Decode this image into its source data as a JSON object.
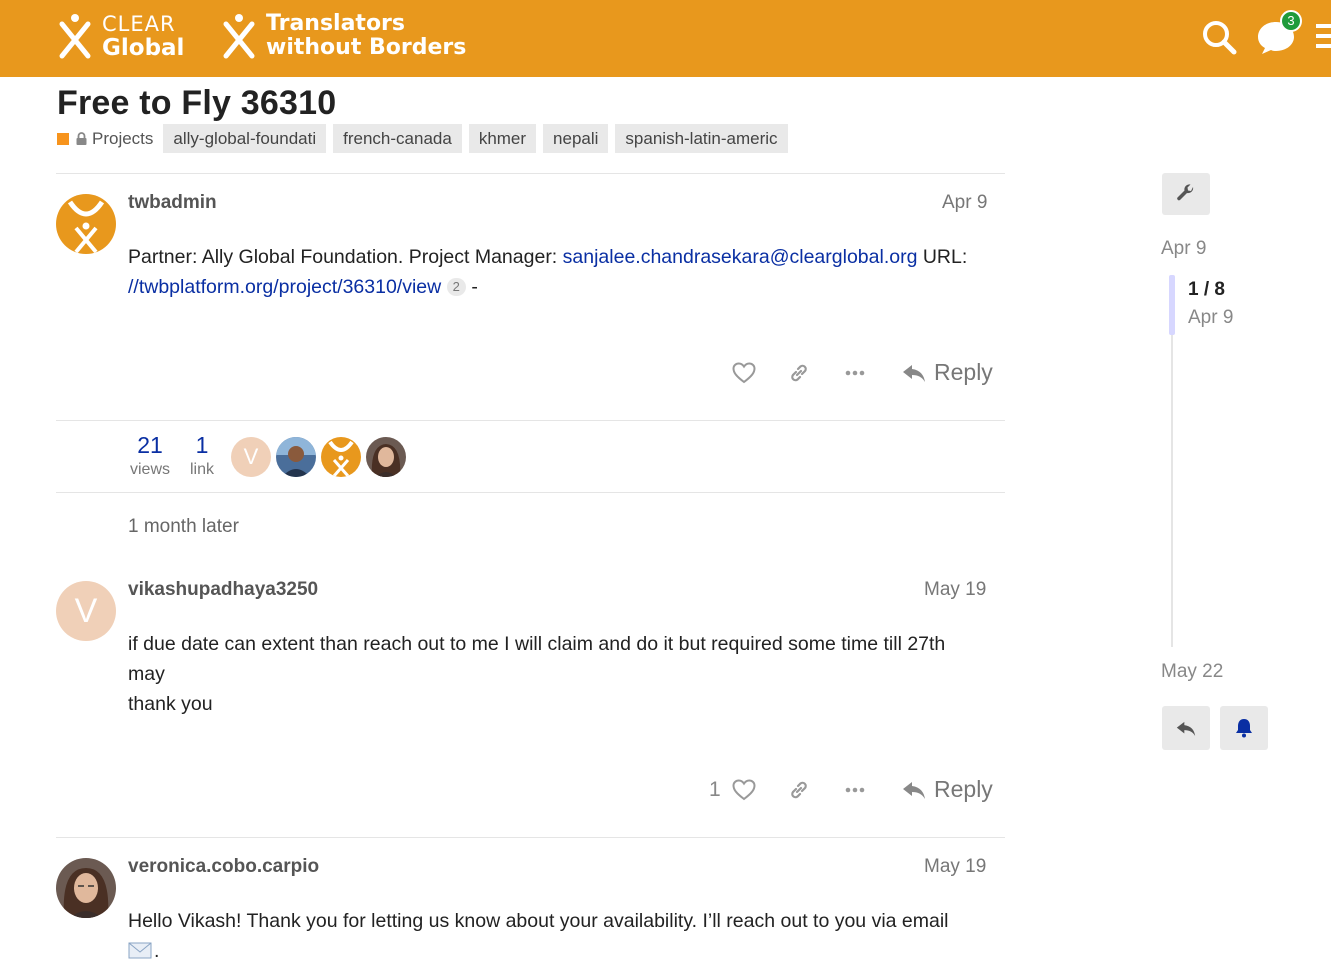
{
  "header": {
    "logo1": {
      "line1": "CLEAR",
      "line2": "Global"
    },
    "logo2": {
      "line1": "Translators",
      "line2": "without Borders"
    },
    "chat_badge": "3",
    "bg_color": "#E8981D"
  },
  "topic": {
    "title": "Free to Fly 36310",
    "category": "Projects",
    "category_color": "#F7941D",
    "tags": [
      "ally-global-foundati",
      "french-canada",
      "khmer",
      "nepali",
      "spanish-latin-americ"
    ]
  },
  "posts": [
    {
      "username": "twbadmin",
      "date": "Apr 9",
      "body_prefix": "Partner: Ally Global Foundation. Project Manager: ",
      "email": "sanjalee.chandrasekara@clearglobal.org",
      "body_mid": " URL:",
      "url": "//twbplatform.org/project/36310/view",
      "url_clicks": "2",
      "body_suffix": " -",
      "reply_label": "Reply"
    },
    {
      "username": "vikashupadhaya3250",
      "date": "May 19",
      "avatar_letter": "V",
      "line1": "if due date can extent than reach out to me I will claim and do it but required some time till 27th",
      "line2": "may",
      "line3": "thank you",
      "like_count": "1",
      "reply_label": "Reply"
    },
    {
      "username": "veronica.cobo.carpio",
      "date": "May 19",
      "body": "Hello Vikash! Thank you for letting us know about your availability. I’ll reach out to you via email"
    }
  ],
  "topic_map": {
    "views": "21",
    "views_label": "views",
    "links": "1",
    "links_label": "link",
    "participant_letter": "V"
  },
  "small_action": "1 month later",
  "timeline": {
    "start_date": "Apr 9",
    "position": "1 / 8",
    "position_date": "Apr 9",
    "end_date": "May 22"
  }
}
